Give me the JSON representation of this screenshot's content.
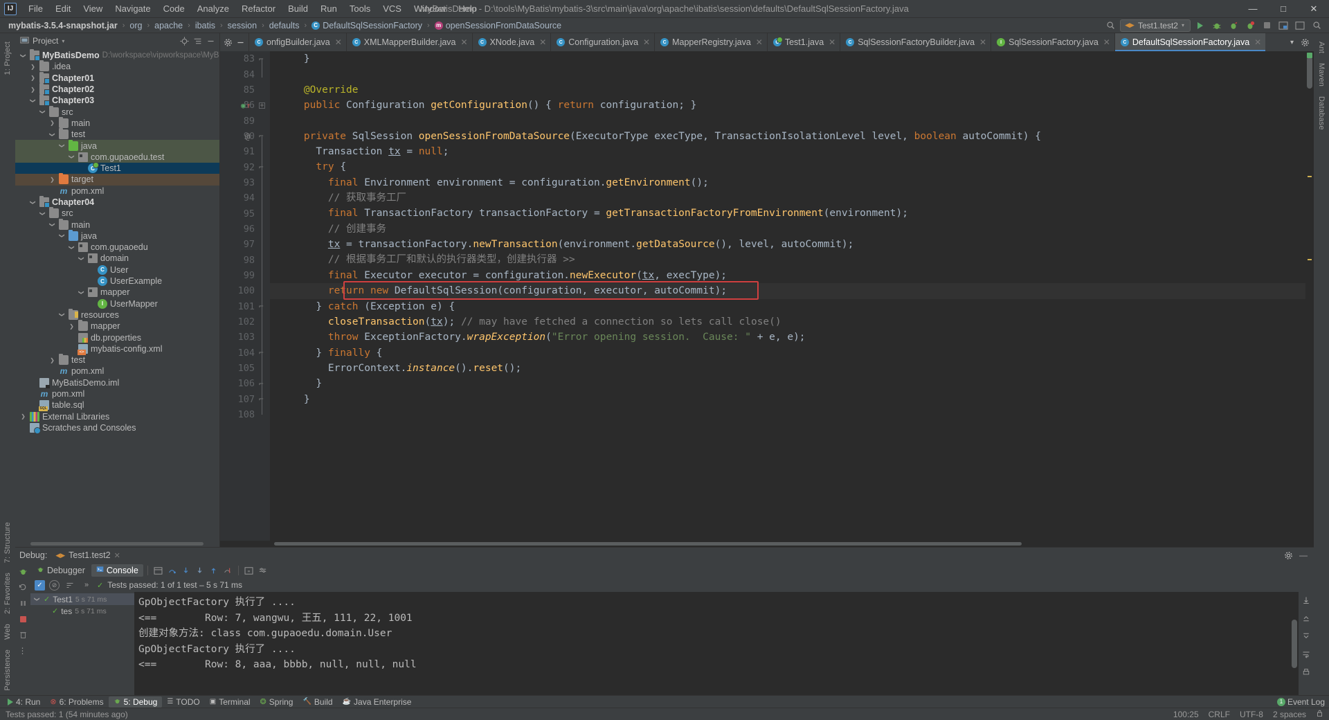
{
  "titlebar": {
    "logo": "IJ",
    "menus": [
      "File",
      "Edit",
      "View",
      "Navigate",
      "Code",
      "Analyze",
      "Refactor",
      "Build",
      "Run",
      "Tools",
      "VCS",
      "Window",
      "Help"
    ],
    "window_title": "MyBatisDemo - D:\\tools\\MyBatis\\mybatis-3\\src\\main\\java\\org\\apache\\ibatis\\session\\defaults\\DefaultSqlSessionFactory.java",
    "minimize": "—",
    "maximize": "□",
    "close": "✕"
  },
  "navbar": {
    "crumbs": [
      {
        "label": "mybatis-3.5.4-snapshot.jar",
        "icon": "none",
        "bold": true
      },
      {
        "label": "org",
        "icon": "none",
        "bold": false
      },
      {
        "label": "apache",
        "icon": "none",
        "bold": false
      },
      {
        "label": "ibatis",
        "icon": "none",
        "bold": false
      },
      {
        "label": "session",
        "icon": "none",
        "bold": false
      },
      {
        "label": "defaults",
        "icon": "none",
        "bold": false
      },
      {
        "label": "DefaultSqlSessionFactory",
        "icon": "class-icon",
        "bold": false
      },
      {
        "label": "openSessionFromDataSource",
        "icon": "method-icon",
        "bold": false
      }
    ],
    "separator": "›",
    "run_config": "Test1.test2",
    "right_icons": [
      "search-everywhere-icon",
      "run-icon",
      "debug-icon",
      "stop-icon",
      "coverage-icon",
      "profile-icon",
      "settings-icon",
      "layout-icon",
      "minimize-icon",
      "search-icon"
    ]
  },
  "left_strip": {
    "top": [
      "1: Project"
    ],
    "bottom": [
      "7: Structure",
      "2: Favorites",
      "Web",
      "Persistence"
    ]
  },
  "right_strip": {
    "items": [
      "Ant",
      "Maven",
      "Database"
    ]
  },
  "project_panel": {
    "title": "Project",
    "dropdown": "▾",
    "right_icons": [
      "locate-icon",
      "collapse-all-icon",
      "hide-icon"
    ],
    "tree": [
      {
        "indent": 0,
        "arrow": "v",
        "icon": "module-icon",
        "label": "MyBatisDemo",
        "bold": true,
        "path": "D:\\workspace\\vipworkspace\\MyBatisDe",
        "state": "none"
      },
      {
        "indent": 1,
        "arrow": ">",
        "icon": "folder-icon",
        "label": ".idea",
        "bold": false,
        "path": "",
        "state": "none"
      },
      {
        "indent": 1,
        "arrow": ">",
        "icon": "module-icon",
        "label": "Chapter01",
        "bold": true,
        "path": "",
        "state": "none"
      },
      {
        "indent": 1,
        "arrow": ">",
        "icon": "module-icon",
        "label": "Chapter02",
        "bold": true,
        "path": "",
        "state": "none"
      },
      {
        "indent": 1,
        "arrow": "v",
        "icon": "module-icon",
        "label": "Chapter03",
        "bold": true,
        "path": "",
        "state": "none"
      },
      {
        "indent": 2,
        "arrow": "v",
        "icon": "folder-icon",
        "label": "src",
        "bold": false,
        "path": "",
        "state": "none"
      },
      {
        "indent": 3,
        "arrow": ">",
        "icon": "folder-icon",
        "label": "main",
        "bold": false,
        "path": "",
        "state": "none"
      },
      {
        "indent": 3,
        "arrow": "v",
        "icon": "folder-icon",
        "label": "test",
        "bold": false,
        "path": "",
        "state": "none"
      },
      {
        "indent": 4,
        "arrow": "v",
        "icon": "source-folder-icon",
        "label": "java",
        "bold": false,
        "path": "",
        "state": "green"
      },
      {
        "indent": 5,
        "arrow": "v",
        "icon": "package-icon",
        "label": "com.gupaoedu.test",
        "bold": false,
        "path": "",
        "state": "green"
      },
      {
        "indent": 6,
        "arrow": "",
        "icon": "test-class-icon",
        "label": "Test1",
        "bold": false,
        "path": "",
        "state": "selected"
      },
      {
        "indent": 3,
        "arrow": ">",
        "icon": "excluded-folder-icon",
        "label": "target",
        "bold": false,
        "path": "",
        "state": "brown"
      },
      {
        "indent": 3,
        "arrow": "",
        "icon": "maven-icon",
        "label": "pom.xml",
        "bold": false,
        "path": "",
        "state": "none"
      },
      {
        "indent": 1,
        "arrow": "v",
        "icon": "module-icon",
        "label": "Chapter04",
        "bold": true,
        "path": "",
        "state": "none"
      },
      {
        "indent": 2,
        "arrow": "v",
        "icon": "folder-icon",
        "label": "src",
        "bold": false,
        "path": "",
        "state": "none"
      },
      {
        "indent": 3,
        "arrow": "v",
        "icon": "folder-icon",
        "label": "main",
        "bold": false,
        "path": "",
        "state": "none"
      },
      {
        "indent": 4,
        "arrow": "v",
        "icon": "source-java-folder-icon",
        "label": "java",
        "bold": false,
        "path": "",
        "state": "none"
      },
      {
        "indent": 5,
        "arrow": "v",
        "icon": "package-icon",
        "label": "com.gupaoedu",
        "bold": false,
        "path": "",
        "state": "none"
      },
      {
        "indent": 6,
        "arrow": "v",
        "icon": "package-icon",
        "label": "domain",
        "bold": false,
        "path": "",
        "state": "none"
      },
      {
        "indent": 7,
        "arrow": "",
        "icon": "class-icon",
        "label": "User",
        "bold": false,
        "path": "",
        "state": "none"
      },
      {
        "indent": 7,
        "arrow": "",
        "icon": "class-icon",
        "label": "UserExample",
        "bold": false,
        "path": "",
        "state": "none"
      },
      {
        "indent": 6,
        "arrow": "v",
        "icon": "package-icon",
        "label": "mapper",
        "bold": false,
        "path": "",
        "state": "none"
      },
      {
        "indent": 7,
        "arrow": "",
        "icon": "interface-icon",
        "label": "UserMapper",
        "bold": false,
        "path": "",
        "state": "none"
      },
      {
        "indent": 4,
        "arrow": "v",
        "icon": "resources-folder-icon",
        "label": "resources",
        "bold": false,
        "path": "",
        "state": "none"
      },
      {
        "indent": 5,
        "arrow": ">",
        "icon": "folder-icon",
        "label": "mapper",
        "bold": false,
        "path": "",
        "state": "none"
      },
      {
        "indent": 5,
        "arrow": "",
        "icon": "properties-icon",
        "label": "db.properties",
        "bold": false,
        "path": "",
        "state": "none"
      },
      {
        "indent": 5,
        "arrow": "",
        "icon": "xml-icon",
        "label": "mybatis-config.xml",
        "bold": false,
        "path": "",
        "state": "none"
      },
      {
        "indent": 3,
        "arrow": ">",
        "icon": "folder-icon",
        "label": "test",
        "bold": false,
        "path": "",
        "state": "none"
      },
      {
        "indent": 3,
        "arrow": "",
        "icon": "maven-icon",
        "label": "pom.xml",
        "bold": false,
        "path": "",
        "state": "none"
      },
      {
        "indent": 1,
        "arrow": "",
        "icon": "iml-icon",
        "label": "MyBatisDemo.iml",
        "bold": false,
        "path": "",
        "state": "none"
      },
      {
        "indent": 1,
        "arrow": "",
        "icon": "maven-icon",
        "label": "pom.xml",
        "bold": false,
        "path": "",
        "state": "none"
      },
      {
        "indent": 1,
        "arrow": "",
        "icon": "sql-icon",
        "label": "table.sql",
        "bold": false,
        "path": "",
        "state": "none"
      },
      {
        "indent": 0,
        "arrow": ">",
        "icon": "library-icon",
        "label": "External Libraries",
        "bold": false,
        "path": "",
        "state": "none"
      },
      {
        "indent": 0,
        "arrow": "",
        "icon": "scratch-icon",
        "label": "Scratches and Consoles",
        "bold": false,
        "path": "",
        "state": "none"
      }
    ]
  },
  "editor": {
    "tabs": [
      {
        "label": "onfigBuilder.java",
        "icon": "class-icon",
        "icon_color": "#3592c4",
        "active": false,
        "truncated": true
      },
      {
        "label": "XMLMapperBuilder.java",
        "icon": "class-icon",
        "icon_color": "#3592c4",
        "active": false
      },
      {
        "label": "XNode.java",
        "icon": "class-icon",
        "icon_color": "#3592c4",
        "active": false
      },
      {
        "label": "Configuration.java",
        "icon": "class-icon",
        "icon_color": "#3592c4",
        "active": false
      },
      {
        "label": "MapperRegistry.java",
        "icon": "class-icon",
        "icon_color": "#3592c4",
        "active": false
      },
      {
        "label": "Test1.java",
        "icon": "test-class-icon",
        "icon_color": "#3592c4",
        "active": false
      },
      {
        "label": "SqlSessionFactoryBuilder.java",
        "icon": "class-icon",
        "icon_color": "#3592c4",
        "active": false
      },
      {
        "label": "SqlSessionFactory.java",
        "icon": "interface-icon",
        "icon_color": "#62b543",
        "active": false
      },
      {
        "label": "DefaultSqlSessionFactory.java",
        "icon": "class-icon",
        "icon_color": "#3592c4",
        "active": true
      }
    ],
    "tab_close": "✕",
    "tabs_right_icons": [
      "chevron-down-icon",
      "settings-icon"
    ],
    "first_line_number": 83,
    "lines": [
      {
        "n": "83",
        "fold": "end",
        "html": "    }"
      },
      {
        "n": "84",
        "fold": "",
        "html": ""
      },
      {
        "n": "85",
        "fold": "",
        "html": "    <span class='ann'>@Override</span>"
      },
      {
        "n": "86",
        "fold": "plus",
        "gutter": "override",
        "html": "    <span class='kw'>public</span> Configuration <span class='fn'>getConfiguration</span>() { <span class='kw'>return</span> configuration; }"
      },
      {
        "n": "89",
        "fold": "",
        "html": ""
      },
      {
        "n": "90",
        "fold": "start",
        "gutter": "at",
        "html": "    <span class='kw'>private</span> SqlSession <span class='fn'>openSessionFromDataSource</span>(ExecutorType execType, TransactionIsolationLevel level, <span class='kw'>boolean</span> autoCommit) {"
      },
      {
        "n": "91",
        "fold": "",
        "html": "      Transaction <span class='uline'>tx</span> = <span class='kw'>null</span>;"
      },
      {
        "n": "92",
        "fold": "start",
        "html": "      <span class='kw'>try</span> {"
      },
      {
        "n": "93",
        "fold": "",
        "html": "        <span class='kw'>final</span> Environment environment = configuration.<span class='fn'>getEnvironment</span>();"
      },
      {
        "n": "94",
        "fold": "",
        "html": "        <span class='cmt'>// 获取事务工厂</span>"
      },
      {
        "n": "95",
        "fold": "",
        "html": "        <span class='kw'>final</span> TransactionFactory transactionFactory = <span class='fn'>getTransactionFactoryFromEnvironment</span>(environment);"
      },
      {
        "n": "96",
        "fold": "",
        "html": "        <span class='cmt'>// 创建事务</span>"
      },
      {
        "n": "97",
        "fold": "",
        "html": "        <span class='uline'>tx</span> = transactionFactory.<span class='fn'>newTransaction</span>(environment.<span class='fn'>getDataSource</span>(), level, autoCommit);"
      },
      {
        "n": "98",
        "fold": "",
        "html": "        <span class='cmt'>// 根据事务工厂和默认的执行器类型，创建执行器 &gt;&gt;</span>"
      },
      {
        "n": "99",
        "fold": "",
        "html": "        <span class='kw'>final</span> Executor executor = configuration.<span class='fn'>newExecutor</span>(<span class='uline'>tx</span>, execType);"
      },
      {
        "n": "100",
        "fold": "",
        "html": "        <span class='kw'>return</span> <span class='kw'>new</span> <span class='type'>DefaultSqlSession</span>(configuration, executor, autoCommit);",
        "highlight": true
      },
      {
        "n": "101",
        "fold": "start",
        "html": "      } <span class='kw'>catch</span> (Exception e) {"
      },
      {
        "n": "102",
        "fold": "",
        "html": "        <span class='fn'>closeTransaction</span>(<span class='uline'>tx</span>); <span class='cmt'>// may have fetched a connection so lets call close()</span>"
      },
      {
        "n": "103",
        "fold": "",
        "html": "        <span class='kw'>throw</span> ExceptionFactory.<span class='ital fn'>wrapException</span>(<span class='str'>\"Error opening session.  Cause: \"</span> + e, e);"
      },
      {
        "n": "104",
        "fold": "end",
        "html": "      } <span class='kw'>finally</span> {"
      },
      {
        "n": "105",
        "fold": "",
        "html": "        ErrorContext.<span class='ital fn'>instance</span>().<span class='fn'>reset</span>();"
      },
      {
        "n": "106",
        "fold": "end",
        "html": "      }"
      },
      {
        "n": "107",
        "fold": "end",
        "html": "    }"
      },
      {
        "n": "108",
        "fold": "",
        "html": ""
      }
    ],
    "highlight_color": "#d04040"
  },
  "debug": {
    "label": "Debug:",
    "session": "Test1.test2",
    "session_close": "✕",
    "tabs": [
      {
        "label": "Debugger",
        "icon": "debugger-icon",
        "active": false
      },
      {
        "label": "Console",
        "icon": "console-icon",
        "active": true
      }
    ],
    "toolbar_icons": [
      "show-hide-icon",
      "step-over-icon",
      "step-into-icon",
      "force-step-into-icon",
      "step-out-icon",
      "run-to-cursor-icon",
      "evaluate-icon",
      "settings-icon"
    ],
    "rail_icons": [
      "rerun-icon",
      "rerun-failed-icon",
      "pause-icon",
      "stop-icon",
      "trash-icon",
      "more-icon"
    ],
    "tests_toolbar": [
      "check-icon",
      "suppress-icon",
      "sort-icon",
      "expand-icon"
    ],
    "tests_status": "Tests passed: 1 of 1 test – 5 s 71 ms",
    "tests_status_prefix": "Tests passed:",
    "tests_status_rest": "1 of 1 test – 5 s 71 ms",
    "tests_tree": [
      {
        "indent": 0,
        "arrow": "v",
        "label": "Test1",
        "duration": "5 s 71 ms",
        "selected": true
      },
      {
        "indent": 1,
        "arrow": "",
        "label": "tes",
        "duration": "5 s 71 ms",
        "selected": false
      }
    ],
    "console_lines": [
      "GpObjectFactory 执行了 ....",
      "<==        Row: 7, wangwu, 王五, 111, 22, 1001",
      "创建对象方法: class com.gupaoedu.domain.User",
      "GpObjectFactory 执行了 ....",
      "<==        Row: 8, aaa, bbbb, null, null, null"
    ],
    "right_rail_icons": [
      "scroll-to-end-icon",
      "scroll-up-icon",
      "scroll-down-icon",
      "soft-wrap-icon",
      "print-icon"
    ]
  },
  "bottom_toolwindows": {
    "items": [
      {
        "label": "4: Run",
        "icon": "run-icon",
        "active": false
      },
      {
        "label": "6: Problems",
        "icon": "problems-icon",
        "active": false
      },
      {
        "label": "5: Debug",
        "icon": "debug-icon",
        "active": true
      },
      {
        "label": "TODO",
        "icon": "todo-icon",
        "active": false
      },
      {
        "label": "Terminal",
        "icon": "terminal-icon",
        "active": false
      },
      {
        "label": "Spring",
        "icon": "spring-icon",
        "active": false
      },
      {
        "label": "Build",
        "icon": "build-icon",
        "active": false
      },
      {
        "label": "Java Enterprise",
        "icon": "java-ee-icon",
        "active": false
      }
    ],
    "event_log": "Event Log",
    "event_log_count": "1"
  },
  "statusbar": {
    "message": "Tests passed: 1 (54 minutes ago)",
    "caret": "100:25",
    "line_sep": "CRLF",
    "encoding": "UTF-8",
    "indent": "2 spaces",
    "lock_icon": "lock-icon"
  }
}
